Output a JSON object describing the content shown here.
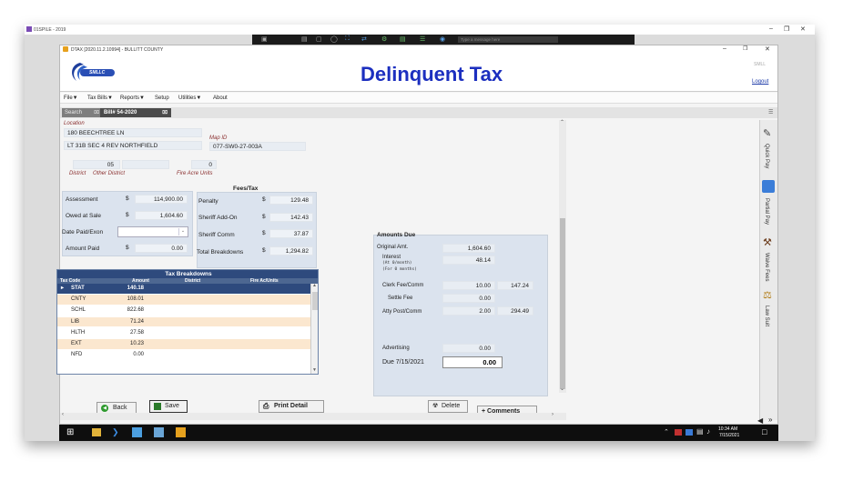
{
  "os": {
    "window_title": "01SPILE - 2019",
    "taskbar_time": "10:34 AM",
    "taskbar_date": "7/15/2021"
  },
  "remote_toolbar": {
    "message_placeholder": "Type a message here"
  },
  "app": {
    "window_title": "DTAX [2020.11.2.10994] - BULLITT COUNTY",
    "title": "Delinquent Tax",
    "logo_text": "SMLLC",
    "header_right": "SMLL",
    "logout": "Logout"
  },
  "menu": [
    "File▼",
    "Tax Bills▼",
    "Reports▼",
    "Setup",
    "Utilities▼",
    "About"
  ],
  "tabs": {
    "search": "Search",
    "bill": "Bill# 54-2020"
  },
  "location": {
    "label": "Location",
    "address": "180 BEECHTREE LN",
    "legal": "LT 31B SEC 4 REV NORTHFIELD",
    "map_id_label": "Map ID",
    "map_id": "077-SW0-27-003A"
  },
  "district": {
    "district_value": "05",
    "other_district_value": "",
    "fire_acre_value": "0",
    "district_label": "District",
    "other_district_label": "Other District",
    "fire_acre_label": "Fire Acre Units"
  },
  "assessment": {
    "assessment_label": "Assessment",
    "assessment_cur": "$",
    "assessment_value": "114,900.00",
    "owed_label": "Owed at Sale",
    "owed_cur": "$",
    "owed_value": "1,604.60",
    "date_paid_label": "Date Paid/Exon",
    "amount_paid_label": "Amount Paid",
    "amount_paid_cur": "$",
    "amount_paid_value": "0.00"
  },
  "fees": {
    "header": "Fees/Tax",
    "penalty_label": "Penalty",
    "penalty_cur": "$",
    "penalty_value": "129.48",
    "sheriff_add_label": "Sheriff Add-On",
    "sheriff_add_cur": "$",
    "sheriff_add_value": "142.43",
    "sheriff_comm_label": "Sheriff Comm",
    "sheriff_comm_cur": "$",
    "sheriff_comm_value": "37.87",
    "total_label": "Total Breakdowns",
    "total_cur": "$",
    "total_value": "1,294.82"
  },
  "tax_breakdowns": {
    "title": "Tax Breakdowns",
    "columns": [
      "Tax Code",
      "Amount",
      "District",
      "Fire Ac/Units"
    ],
    "rows": [
      {
        "code": "STAT",
        "amount": "140.18"
      },
      {
        "code": "CNTY",
        "amount": "108.01"
      },
      {
        "code": "SCHL",
        "amount": "822.68"
      },
      {
        "code": "LIB",
        "amount": "71.24"
      },
      {
        "code": "HLTH",
        "amount": "27.58"
      },
      {
        "code": "EXT",
        "amount": "10.23"
      },
      {
        "code": "NFD",
        "amount": "0.00"
      }
    ]
  },
  "amounts_due": {
    "title": "Amounts Due",
    "original_label": "Original Amt.",
    "original_value": "1,604.60",
    "interest_label": "Interest",
    "interest_value": "48.14",
    "interest_rate": "(At 0/month)",
    "interest_months": "(For 0 months)",
    "clerk_label": "Clerk Fee/Comm",
    "clerk_value": "10.00",
    "clerk_total": "147.24",
    "settle_label": "Settle Fee",
    "settle_value": "0.00",
    "atty_label": "Atty Post/Comm",
    "atty_value": "2.00",
    "atty_total": "294.49",
    "advertising_label": "Advertising",
    "advertising_value": "0.00",
    "due_label": "Due 7/15/2021",
    "due_value": "0.00"
  },
  "buttons": {
    "back": "Back",
    "save": "Save",
    "print": "Print Detail",
    "delete": "Delete",
    "comments": "+ Comments"
  },
  "side_panel": [
    "Quick Pay",
    "Partial Pay",
    "Waive Fees",
    "Law Suit"
  ]
}
